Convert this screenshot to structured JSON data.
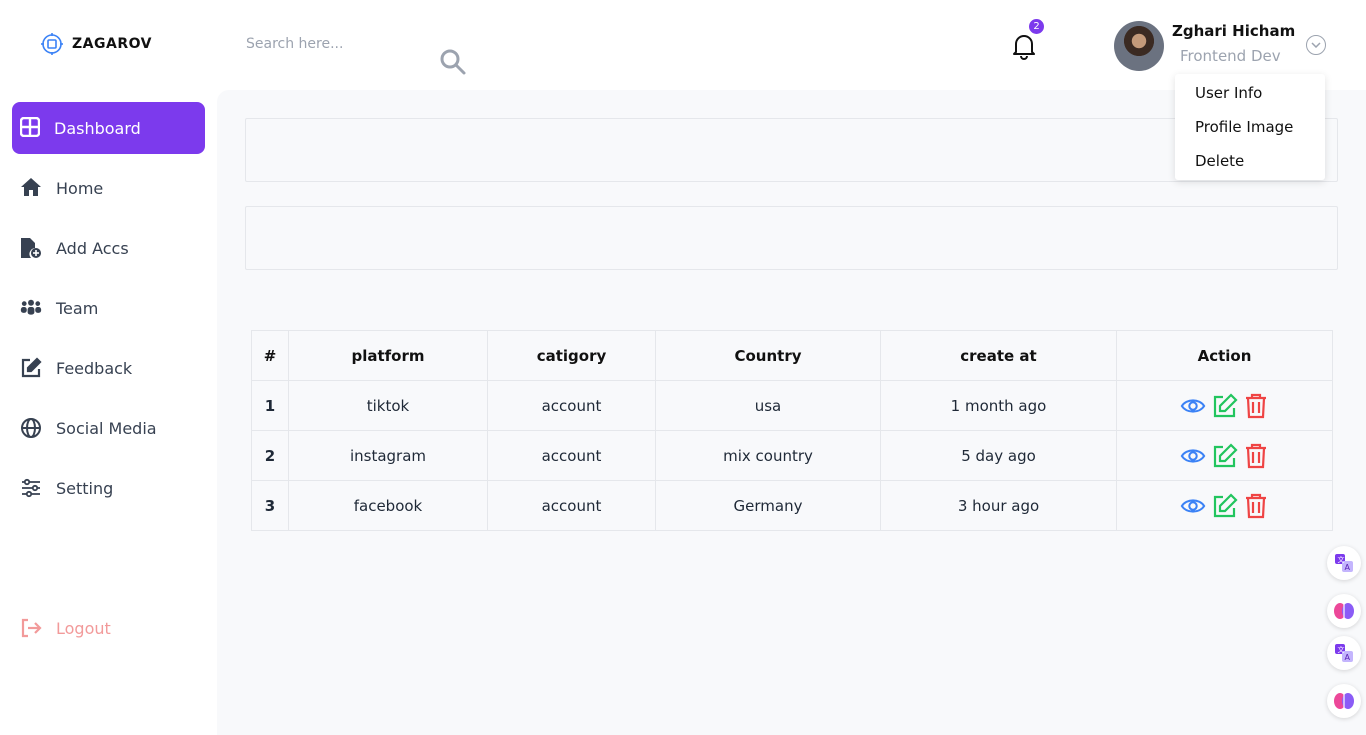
{
  "brand": {
    "name": "ZAGAROV"
  },
  "search": {
    "placeholder": "Search here..."
  },
  "notifications": {
    "count": "2"
  },
  "user": {
    "name": "Zghari Hicham",
    "role": "Frontend Dev"
  },
  "user_menu": {
    "items": [
      "User Info",
      "Profile Image",
      "Delete"
    ]
  },
  "sidebar": {
    "items": [
      {
        "label": "Dashboard",
        "icon": "grid-icon"
      },
      {
        "label": "Home",
        "icon": "home-icon"
      },
      {
        "label": "Add Accs",
        "icon": "file-plus-icon"
      },
      {
        "label": "Team",
        "icon": "users-icon"
      },
      {
        "label": "Feedback",
        "icon": "edit-icon"
      },
      {
        "label": "Social Media",
        "icon": "globe-icon"
      },
      {
        "label": "Setting",
        "icon": "sliders-icon"
      }
    ],
    "logout": "Logout"
  },
  "table": {
    "headers": [
      "#",
      "platform",
      "catigory",
      "Country",
      "create at",
      "Action"
    ],
    "rows": [
      [
        "1",
        "tiktok",
        "account",
        "usa",
        "1 month ago"
      ],
      [
        "2",
        "instagram",
        "account",
        "mix country",
        "5 day ago"
      ],
      [
        "3",
        "facebook",
        "account",
        "Germany",
        "3 hour ago"
      ]
    ]
  },
  "colors": {
    "accent": "#7c3aed",
    "view": "#3b82f6",
    "edit": "#22c55e",
    "delete": "#ef4444",
    "logout": "#f29a9a"
  }
}
